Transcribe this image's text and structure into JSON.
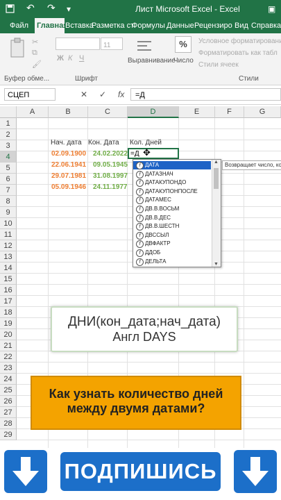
{
  "titlebar": {
    "title": "Лист Microsoft Excel  -  Excel"
  },
  "ribbon_tabs": [
    "Файл",
    "Главная",
    "Вставка",
    "Разметка стр",
    "Формулы",
    "Данные",
    "Рецензиров",
    "Вид",
    "Справка"
  ],
  "ribbon": {
    "paste_group_label": "Буфер обме...",
    "font_group_label": "Шрифт",
    "font_size": "11",
    "align_label": "Выравнивание",
    "number_label": "Число",
    "percent_symbol": "%",
    "styles": [
      "Условное форматирование",
      "Форматировать как табл",
      "Стили ячеек"
    ],
    "styles_group_label": "Стили"
  },
  "formula_bar": {
    "name_box": "СЦЕП",
    "fx": "fx",
    "value": "=Д"
  },
  "columns": [
    "A",
    "B",
    "C",
    "D",
    "E",
    "F",
    "G"
  ],
  "rows": [
    "1",
    "2",
    "3",
    "4",
    "5",
    "6",
    "7",
    "8",
    "9",
    "10",
    "11",
    "12",
    "13",
    "14",
    "15",
    "16",
    "17",
    "18",
    "19",
    "20",
    "21",
    "22",
    "23",
    "24",
    "25",
    "26",
    "27",
    "28",
    "29"
  ],
  "headers": {
    "start": "Нач. дата",
    "end": "Кон. Дата",
    "days": "Кол. Дней"
  },
  "data_rows": [
    {
      "start": "02.09.1900",
      "end": "24.02.2022"
    },
    {
      "start": "22.06.1941",
      "end": "09.05.1945"
    },
    {
      "start": "29.07.1981",
      "end": "31.08.1997"
    },
    {
      "start": "05.09.1946",
      "end": "24.11.1977"
    }
  ],
  "active_cell_text": "=Д",
  "autocomplete": [
    "ДАТА",
    "ДАТАЗНАЧ",
    "ДАТАКУПОНДО",
    "ДАТАКУПОНПОСЛЕ",
    "ДАТАМЕС",
    "ДВ.В.ВОСЬМ",
    "ДВ.В.ДЕС",
    "ДВ.В.ШЕСТН",
    "ДВССЫЛ",
    "ДВФАКТР",
    "ДДОБ",
    "ДЕЛЬТА"
  ],
  "tooltip": "Возвращает число, которое",
  "callout_formula": {
    "line1": "ДНИ(кон_дата;нач_дата)",
    "line2": "Англ DAYS"
  },
  "callout_question": {
    "line1": "Как узнать количество дней",
    "line2": "между двумя датами?"
  },
  "subscribe": "ПОДПИШИСЬ",
  "colors": {
    "excel_green": "#217346",
    "orange_date": "#ed7d31",
    "green_date": "#70ad47",
    "callout_orange": "#f4a300",
    "button_blue": "#1c6fc9"
  }
}
